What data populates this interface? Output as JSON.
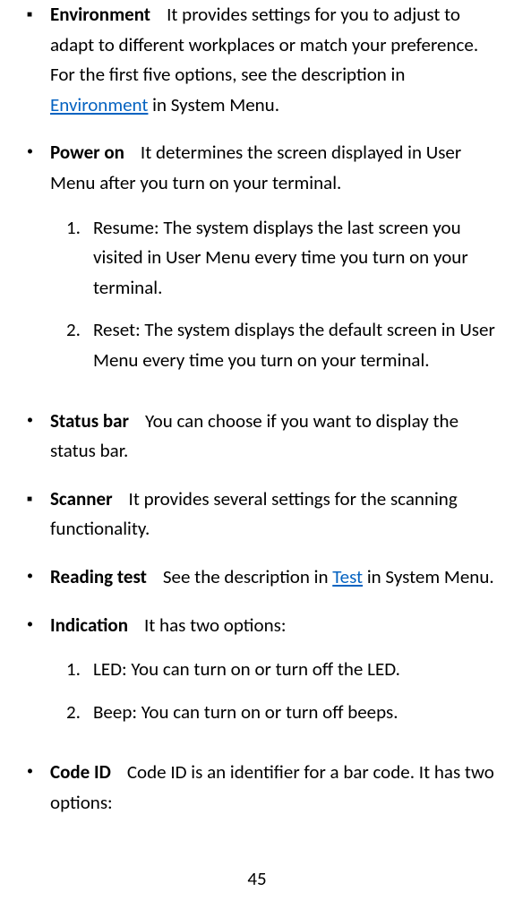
{
  "items": [
    {
      "bullet": "■",
      "bulletType": "square",
      "term": "Environment",
      "desc_before_link": "It provides settings for you to adjust to adapt to different workplaces or match your preference. For the first five options, see the description in ",
      "link": "Environment",
      "desc_after_link": " in System Menu.",
      "subs": []
    },
    {
      "bullet": "•",
      "bulletType": "dot",
      "term": "Power on",
      "desc_before_link": "It determines the screen displayed in User Menu after you turn on your terminal.",
      "link": "",
      "desc_after_link": "",
      "subs": [
        {
          "num": "1.",
          "text": "Resume: The system displays the last screen you visited in User Menu every time you turn on your terminal."
        },
        {
          "num": "2.",
          "text": "Reset: The system displays the default screen in User Menu every time you turn on your terminal."
        }
      ]
    },
    {
      "bullet": "•",
      "bulletType": "dot",
      "term": "Status bar",
      "desc_before_link": "You can choose if you want to display the status bar.",
      "link": "",
      "desc_after_link": "",
      "subs": []
    },
    {
      "bullet": "■",
      "bulletType": "square",
      "term": "Scanner",
      "desc_before_link": "It provides several settings for the scanning functionality.",
      "link": "",
      "desc_after_link": "",
      "subs": []
    },
    {
      "bullet": "•",
      "bulletType": "dot",
      "term": "Reading test",
      "desc_before_link": "See the description in ",
      "link": "Test",
      "desc_after_link": " in System Menu.",
      "subs": []
    },
    {
      "bullet": "•",
      "bulletType": "dot",
      "term": "Indication",
      "desc_before_link": "It has two options:",
      "link": "",
      "desc_after_link": "",
      "subs": [
        {
          "num": "1.",
          "text": "LED: You can turn on or turn off the LED."
        },
        {
          "num": "2.",
          "text": "Beep: You can turn on or turn off beeps."
        }
      ]
    },
    {
      "bullet": "•",
      "bulletType": "dot",
      "term": "Code ID",
      "desc_before_link": "Code ID is an identifier for a bar code. It has two options:",
      "link": "",
      "desc_after_link": "",
      "subs": []
    }
  ],
  "page_number": "45"
}
